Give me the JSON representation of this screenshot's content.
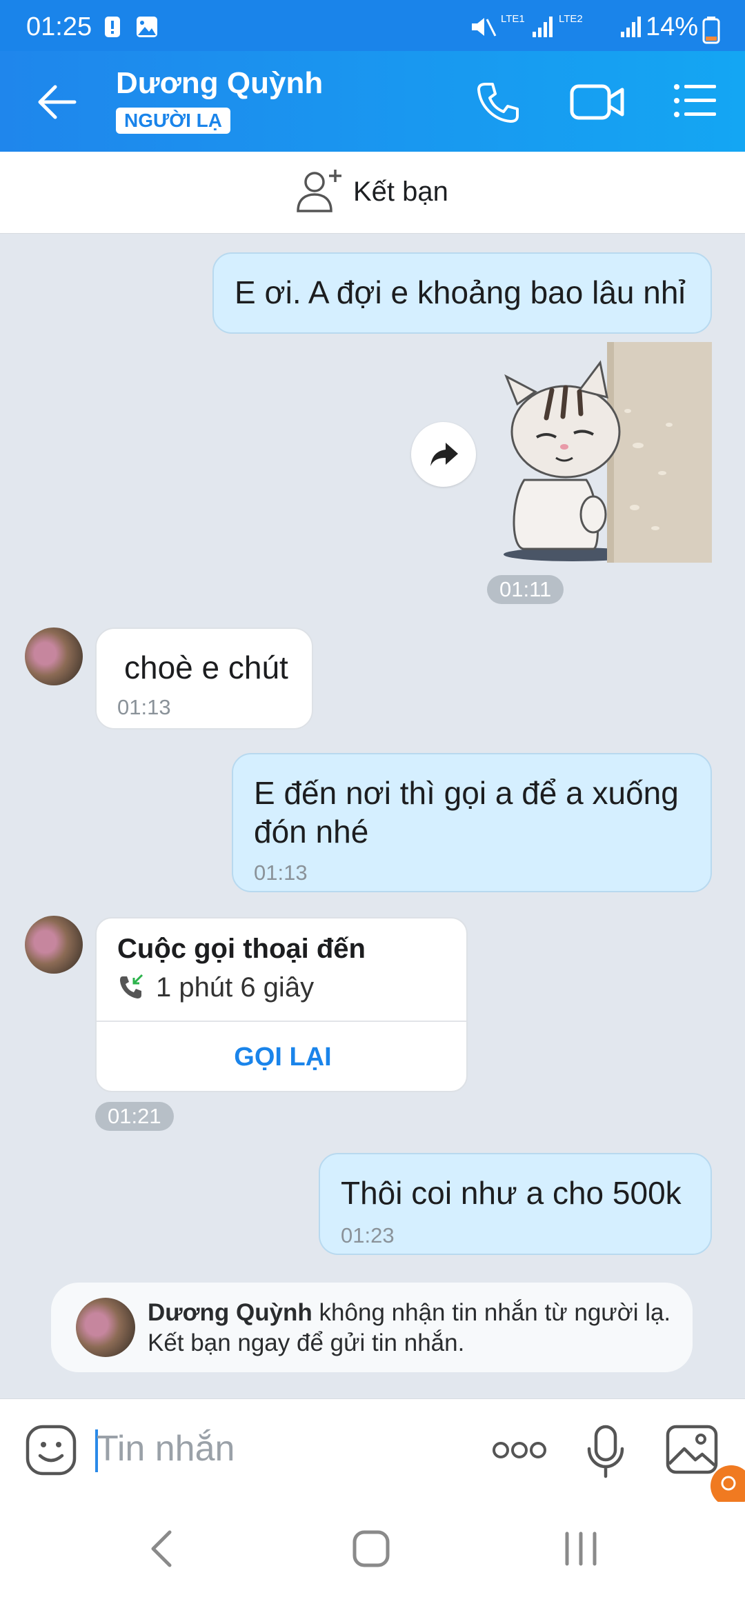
{
  "status_bar": {
    "time": "01:25",
    "sim1": "LTE1",
    "sim2": "LTE2",
    "battery": "14%"
  },
  "header": {
    "title": "Dương Quỳnh",
    "badge": "NGƯỜI LẠ"
  },
  "add_friend": {
    "label": "Kết bạn"
  },
  "messages": {
    "m1": {
      "text": "E ơi. A đợi e khoảng bao lâu nhỉ"
    },
    "sticker_time": "01:11",
    "m2": {
      "text": "choè e chút",
      "time": "01:13"
    },
    "m3": {
      "line1": "E đến nơi thì gọi a để a xuống",
      "line2": "đón nhé",
      "time": "01:13"
    },
    "call": {
      "title": "Cuộc gọi thoại đến",
      "duration": "1 phút 6 giây",
      "action": "GỌI LẠI",
      "time": "01:21"
    },
    "m4": {
      "text": "Thôi coi như a cho 500k",
      "time": "01:23"
    }
  },
  "notice": {
    "name": "Dương Quỳnh",
    "line1_rest": " không nhận tin nhắn từ người lạ.",
    "line2": "Kết bạn ngay để gửi tin nhắn."
  },
  "input": {
    "placeholder": "Tin nhắn"
  },
  "colors": {
    "header": "#1a84ea",
    "my_bubble": "#d5efff",
    "accent": "#1a84ea"
  }
}
